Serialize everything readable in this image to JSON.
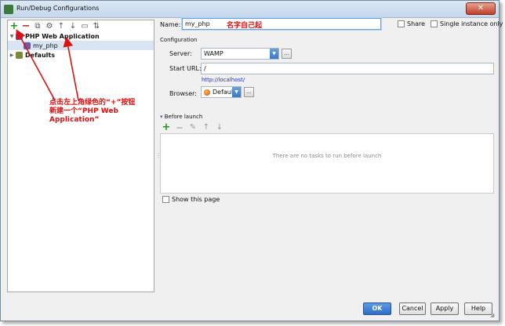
{
  "window": {
    "title": "Run/Debug Configurations",
    "close_symbol": "✕"
  },
  "toolbar": {
    "add_symbol": "+",
    "remove_symbol": "−",
    "copy_symbol": "⧉",
    "settings_symbol": "⚙",
    "up_symbol": "↑",
    "down_symbol": "↓",
    "folder_symbol": "▭",
    "sort_symbol": "⇅"
  },
  "tree": {
    "items": [
      {
        "label": "PHP Web Application",
        "expander": "▼"
      },
      {
        "label": "my_php"
      },
      {
        "label": "Defaults",
        "expander": "▶"
      }
    ]
  },
  "annotation": {
    "line1": "点击左上角绿色的“+”按钮",
    "line2": "新建一个“PHP Web",
    "line3": "Application”",
    "color": "#e01010"
  },
  "form": {
    "name_label": "Name:",
    "name_value": "my_php",
    "name_note": "名字自己起",
    "share_label": "Share",
    "single_instance_label": "Single instance only",
    "configuration_heading": "Configuration",
    "server_label": "Server:",
    "server_value": "WAMP",
    "server_more": "...",
    "start_url_label": "Start URL:",
    "start_url_value": "/",
    "start_url_hint": "http://localhost/",
    "browser_label": "Browser:",
    "browser_value": "Default",
    "browser_more": "..."
  },
  "before_launch": {
    "heading": "Before launch",
    "empty_text": "There are no tasks to run before launch",
    "add_symbol": "+",
    "remove_symbol": "−",
    "edit_symbol": "✎",
    "up_symbol": "↑",
    "down_symbol": "↓",
    "show_page_label": "Show this page"
  },
  "buttons": {
    "ok": "OK",
    "cancel": "Cancel",
    "apply": "Apply",
    "help": "Help"
  },
  "colors": {
    "accent": "#2d6cc8",
    "annotation": "#e01010",
    "link": "#2233cc"
  }
}
